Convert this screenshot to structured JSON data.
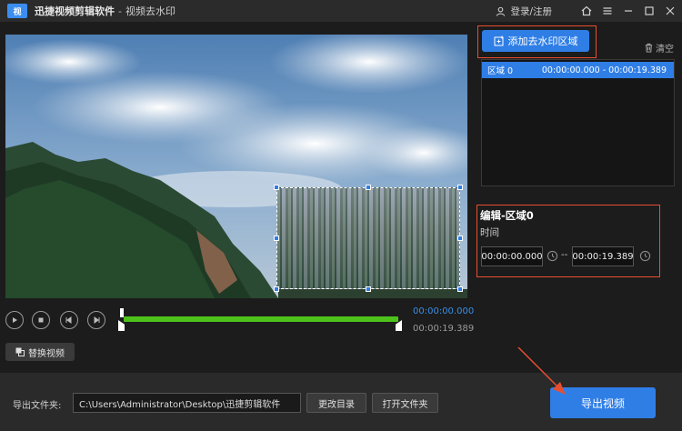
{
  "app": {
    "logo_text": "视",
    "name": "迅捷视频剪辑软件",
    "separator": "-",
    "page": "视频去水印"
  },
  "titlebar": {
    "login_label": "登录/注册",
    "icons": [
      "user-icon",
      "home-icon",
      "menu-icon",
      "minimize-icon",
      "maximize-icon",
      "close-icon"
    ]
  },
  "player": {
    "current_time": "00:00:00.000",
    "total_time": "00:00:19.389",
    "controls": [
      "play-icon",
      "stop-icon",
      "previous-frame-icon",
      "next-frame-icon"
    ],
    "replace_video_label": "替换视频"
  },
  "regions": {
    "add_button_label": "添加去水印区域",
    "clear_label": "清空",
    "items": [
      {
        "name": "区域 0",
        "range": "00:00:00.000 - 00:00:19.389"
      }
    ]
  },
  "edit": {
    "title": "编辑-区域0",
    "time_label": "时间",
    "start": "00:00:00.000",
    "dash": "--",
    "end": "00:00:19.389"
  },
  "export": {
    "folder_label": "导出文件夹:",
    "folder_path": "C:\\Users\\Administrator\\Desktop\\迅捷剪辑软件",
    "change_dir_label": "更改目录",
    "open_folder_label": "打开文件夹",
    "export_button_label": "导出视频"
  },
  "colors": {
    "accent": "#2f7ee6",
    "highlight_box": "#e84e30",
    "timeline": "#4cc21a"
  }
}
